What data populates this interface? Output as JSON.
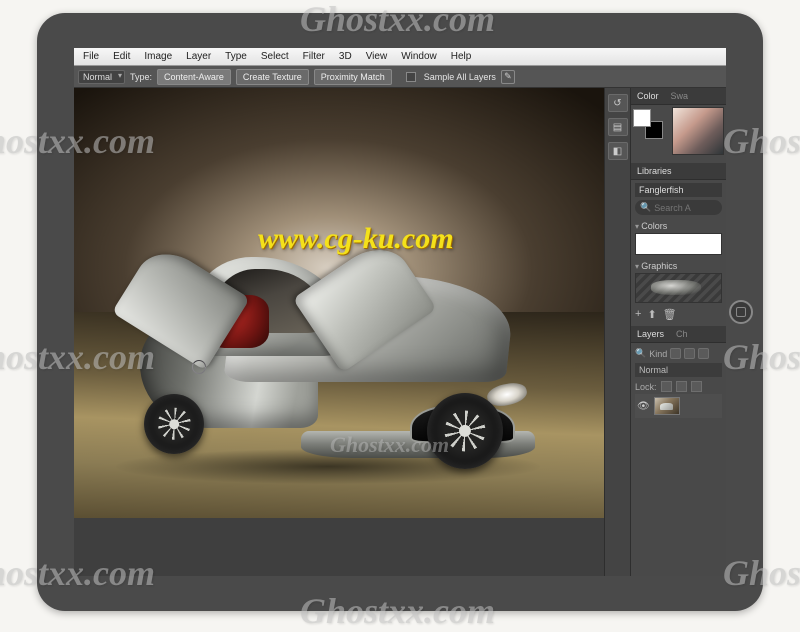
{
  "watermarks": {
    "corner": "Ghostxx.com",
    "url": "www.cg-ku.com"
  },
  "menubar": [
    "File",
    "Edit",
    "Image",
    "Layer",
    "Type",
    "Select",
    "Filter",
    "3D",
    "View",
    "Window",
    "Help"
  ],
  "options": {
    "mode": "Normal",
    "type_label": "Type:",
    "content_aware": "Content-Aware",
    "create_texture": "Create Texture",
    "proximity_match": "Proximity Match",
    "sample_all": "Sample All Layers"
  },
  "panels": {
    "color": {
      "tab1": "Color",
      "tab2": "Swa"
    },
    "libraries": {
      "title": "Libraries",
      "lib_name": "Fanglerfish",
      "search_placeholder": "Search A",
      "section_colors": "Colors",
      "section_graphics": "Graphics"
    },
    "layers": {
      "tab1": "Layers",
      "tab2": "Ch",
      "kind": "Kind",
      "blend": "Normal",
      "lock": "Lock:"
    }
  }
}
